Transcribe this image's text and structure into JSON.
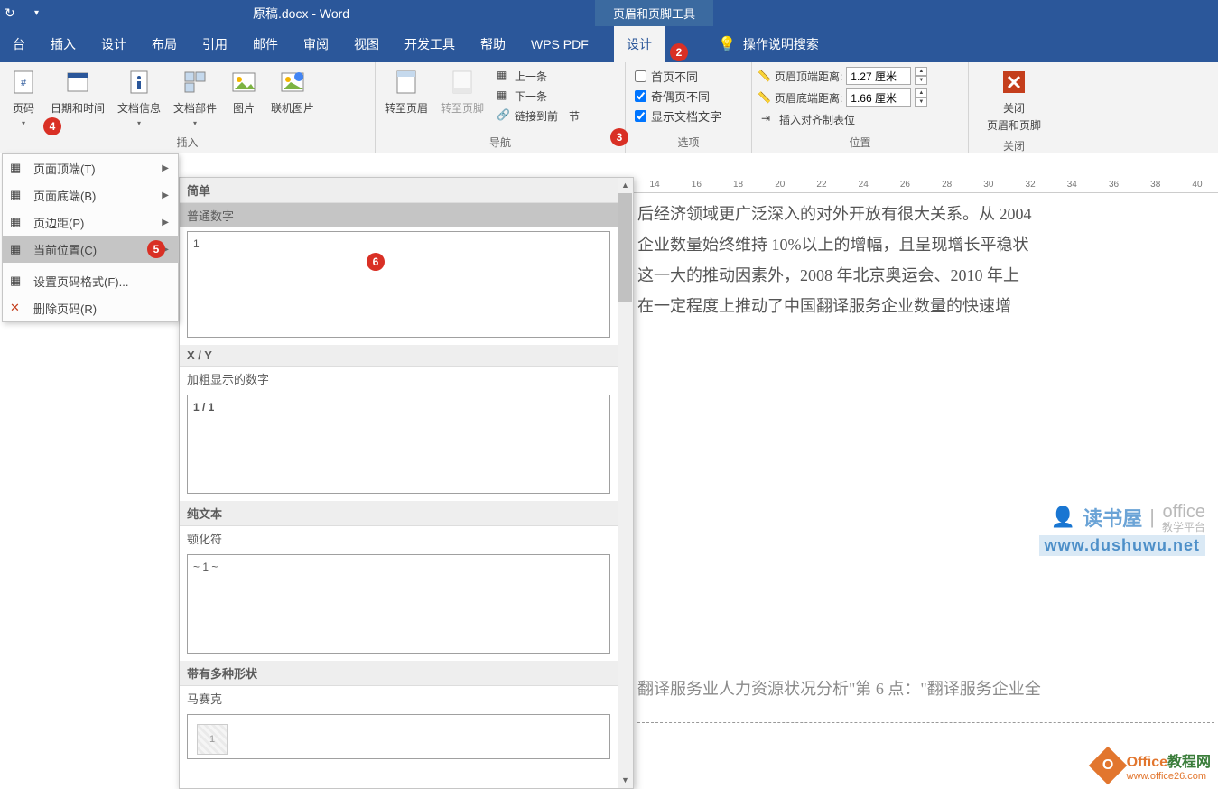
{
  "titlebar": {
    "doc_title": "原稿.docx  -  Word",
    "context_tab": "页眉和页脚工具"
  },
  "tabs": {
    "items": [
      "台",
      "插入",
      "设计",
      "布局",
      "引用",
      "邮件",
      "审阅",
      "视图",
      "开发工具",
      "帮助",
      "WPS PDF",
      "设计"
    ],
    "active_index": 11,
    "search_label": "操作说明搜索"
  },
  "ribbon": {
    "insert": {
      "page_number": "页码",
      "date_time": "日期和时间",
      "doc_info": "文档信息",
      "doc_parts": "文档部件",
      "picture": "图片",
      "online_pic": "联机图片",
      "label": "插入"
    },
    "nav": {
      "goto_header": "转至页眉",
      "goto_footer": "转至页脚",
      "previous": "上一条",
      "next": "下一条",
      "link_prev": "链接到前一节",
      "label": "导航"
    },
    "options": {
      "first_diff": "首页不同",
      "odd_even": "奇偶页不同",
      "show_text": "显示文档文字",
      "label": "选项"
    },
    "position": {
      "header_top": "页眉顶端距离:",
      "header_top_val": "1.27 厘米",
      "footer_bottom": "页眉底端距离:",
      "footer_bottom_val": "1.66 厘米",
      "align_tab": "插入对齐制表位",
      "label": "位置"
    },
    "close": {
      "line1": "关闭",
      "line2": "页眉和页脚",
      "label": "关闭"
    }
  },
  "dropdown": {
    "items": [
      {
        "label": "页面顶端(T)",
        "sub": true
      },
      {
        "label": "页面底端(B)",
        "sub": true
      },
      {
        "label": "页边距(P)",
        "sub": true
      },
      {
        "label": "当前位置(C)",
        "sub": true,
        "hover": true
      },
      {
        "label": "设置页码格式(F)...",
        "sub": false
      },
      {
        "label": "删除页码(R)",
        "sub": false
      }
    ]
  },
  "gallery": {
    "h_simple": "简单",
    "s_plain": "普通数字",
    "v_plain": "1",
    "h_xy": "X / Y",
    "s_bold": "加粗显示的数字",
    "v_bold": "1 / 1",
    "h_text": "纯文本",
    "s_tilde": "颚化符",
    "v_tilde": "~ 1 ~",
    "h_shapes": "带有多种形状",
    "s_mosaic": "马赛克",
    "v_mosaic": "1"
  },
  "ruler": {
    "marks": [
      "14",
      "16",
      "18",
      "20",
      "22",
      "24",
      "26",
      "28",
      "30",
      "32",
      "34",
      "36",
      "38",
      "40"
    ]
  },
  "document": {
    "para1_l1": "后经济领域更广泛深入的对外开放有很大关系。从 2004",
    "para1_l2": "企业数量始终维持 10%以上的增幅，且呈现增长平稳状",
    "para1_l3": "这一大的推动因素外，2008 年北京奥运会、2010 年上",
    "para1_l4": "在一定程度上推动了中国翻译服务企业数量的快速增",
    "para2": "翻译服务业人力资源状况分析\"第 6 点：\"翻译服务企业全"
  },
  "watermark1": {
    "brand": "读书屋",
    "office": "office",
    "sub": "教学平台",
    "url": "www.dushuwu.net"
  },
  "watermark2": {
    "hex": "O",
    "t1": "Office",
    "t2": "教程网",
    "url": "www.office26.com"
  },
  "badges": {
    "b2": "2",
    "b3": "3",
    "b4": "4",
    "b5": "5",
    "b6": "6"
  }
}
